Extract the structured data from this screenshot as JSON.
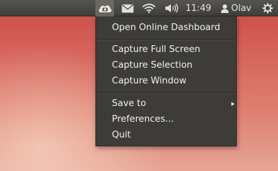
{
  "panel": {
    "clock": "11:49",
    "user_name": "Olav",
    "icons": [
      "cloud-camera-icon",
      "envelope-icon",
      "wifi-icon",
      "volume-icon",
      "user-icon",
      "power-icon"
    ]
  },
  "menu": {
    "items": [
      {
        "label": "Open Online Dashboard"
      },
      {
        "label": "Capture Full Screen"
      },
      {
        "label": "Capture Selection"
      },
      {
        "label": "Capture Window"
      },
      {
        "label": "Save to",
        "submenu": true
      },
      {
        "label": "Preferences..."
      },
      {
        "label": "Quit"
      }
    ]
  }
}
